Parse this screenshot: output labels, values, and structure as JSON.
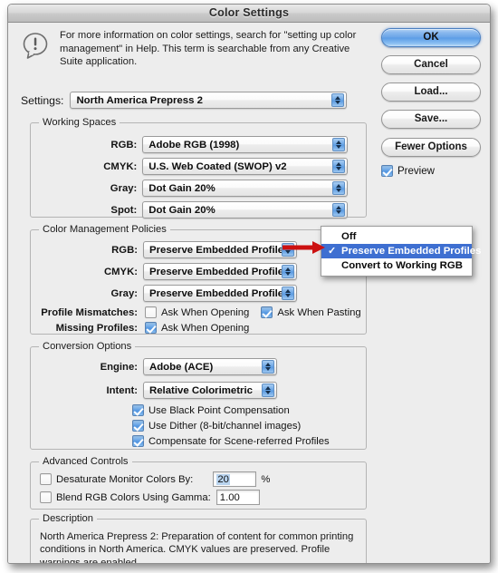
{
  "window": {
    "title": "Color Settings"
  },
  "info": {
    "icon": "exclamation-bubble-icon",
    "text": "For more information on color settings, search for \"setting up color management\" in Help. This term is searchable from any Creative Suite application."
  },
  "buttons": {
    "ok": "OK",
    "cancel": "Cancel",
    "load": "Load...",
    "save": "Save...",
    "fewer_options": "Fewer Options",
    "preview_label": "Preview",
    "preview_checked": true
  },
  "settings": {
    "label": "Settings:",
    "value": "North America Prepress 2"
  },
  "working_spaces": {
    "legend": "Working Spaces",
    "rows": [
      {
        "label": "RGB:",
        "value": "Adobe RGB (1998)"
      },
      {
        "label": "CMYK:",
        "value": "U.S. Web Coated (SWOP) v2"
      },
      {
        "label": "Gray:",
        "value": "Dot Gain 20%"
      },
      {
        "label": "Spot:",
        "value": "Dot Gain 20%"
      }
    ]
  },
  "color_management_policies": {
    "legend": "Color Management Policies",
    "rows": [
      {
        "label": "RGB:",
        "value": "Preserve Embedded Profiles"
      },
      {
        "label": "CMYK:",
        "value": "Preserve Embedded Profiles"
      },
      {
        "label": "Gray:",
        "value": "Preserve Embedded Profiles"
      }
    ],
    "profile_mismatches": {
      "label": "Profile Mismatches:",
      "ask_when_opening": {
        "label": "Ask When Opening",
        "checked": false
      },
      "ask_when_pasting": {
        "label": "Ask When Pasting",
        "checked": true
      }
    },
    "missing_profiles": {
      "label": "Missing Profiles:",
      "ask_when_opening": {
        "label": "Ask When Opening",
        "checked": true
      }
    }
  },
  "popup_menu": {
    "items": [
      {
        "label": "Off",
        "checked": false,
        "selected": false
      },
      {
        "label": "Preserve Embedded Profiles",
        "checked": true,
        "selected": true
      },
      {
        "label": "Convert to Working RGB",
        "checked": false,
        "selected": false
      }
    ],
    "checkmark": "✓",
    "highlight_color": "#3e6fd1"
  },
  "annotation": {
    "arrow_color": "#cc1111"
  },
  "conversion_options": {
    "legend": "Conversion Options",
    "engine": {
      "label": "Engine:",
      "value": "Adobe (ACE)"
    },
    "intent": {
      "label": "Intent:",
      "value": "Relative Colorimetric"
    },
    "checkboxes": [
      {
        "label": "Use Black Point Compensation",
        "checked": true
      },
      {
        "label": "Use Dither (8-bit/channel images)",
        "checked": true
      },
      {
        "label": "Compensate for Scene-referred Profiles",
        "checked": true
      }
    ]
  },
  "advanced_controls": {
    "legend": "Advanced Controls",
    "desaturate": {
      "label": "Desaturate Monitor Colors By:",
      "checked": false,
      "value": "20",
      "unit": "%"
    },
    "blend_gamma": {
      "label": "Blend RGB Colors Using Gamma:",
      "checked": false,
      "value": "1.00"
    }
  },
  "description": {
    "legend": "Description",
    "text": "North America Prepress 2:  Preparation of content for common printing conditions in North America. CMYK values are preserved. Profile warnings are enabled."
  }
}
